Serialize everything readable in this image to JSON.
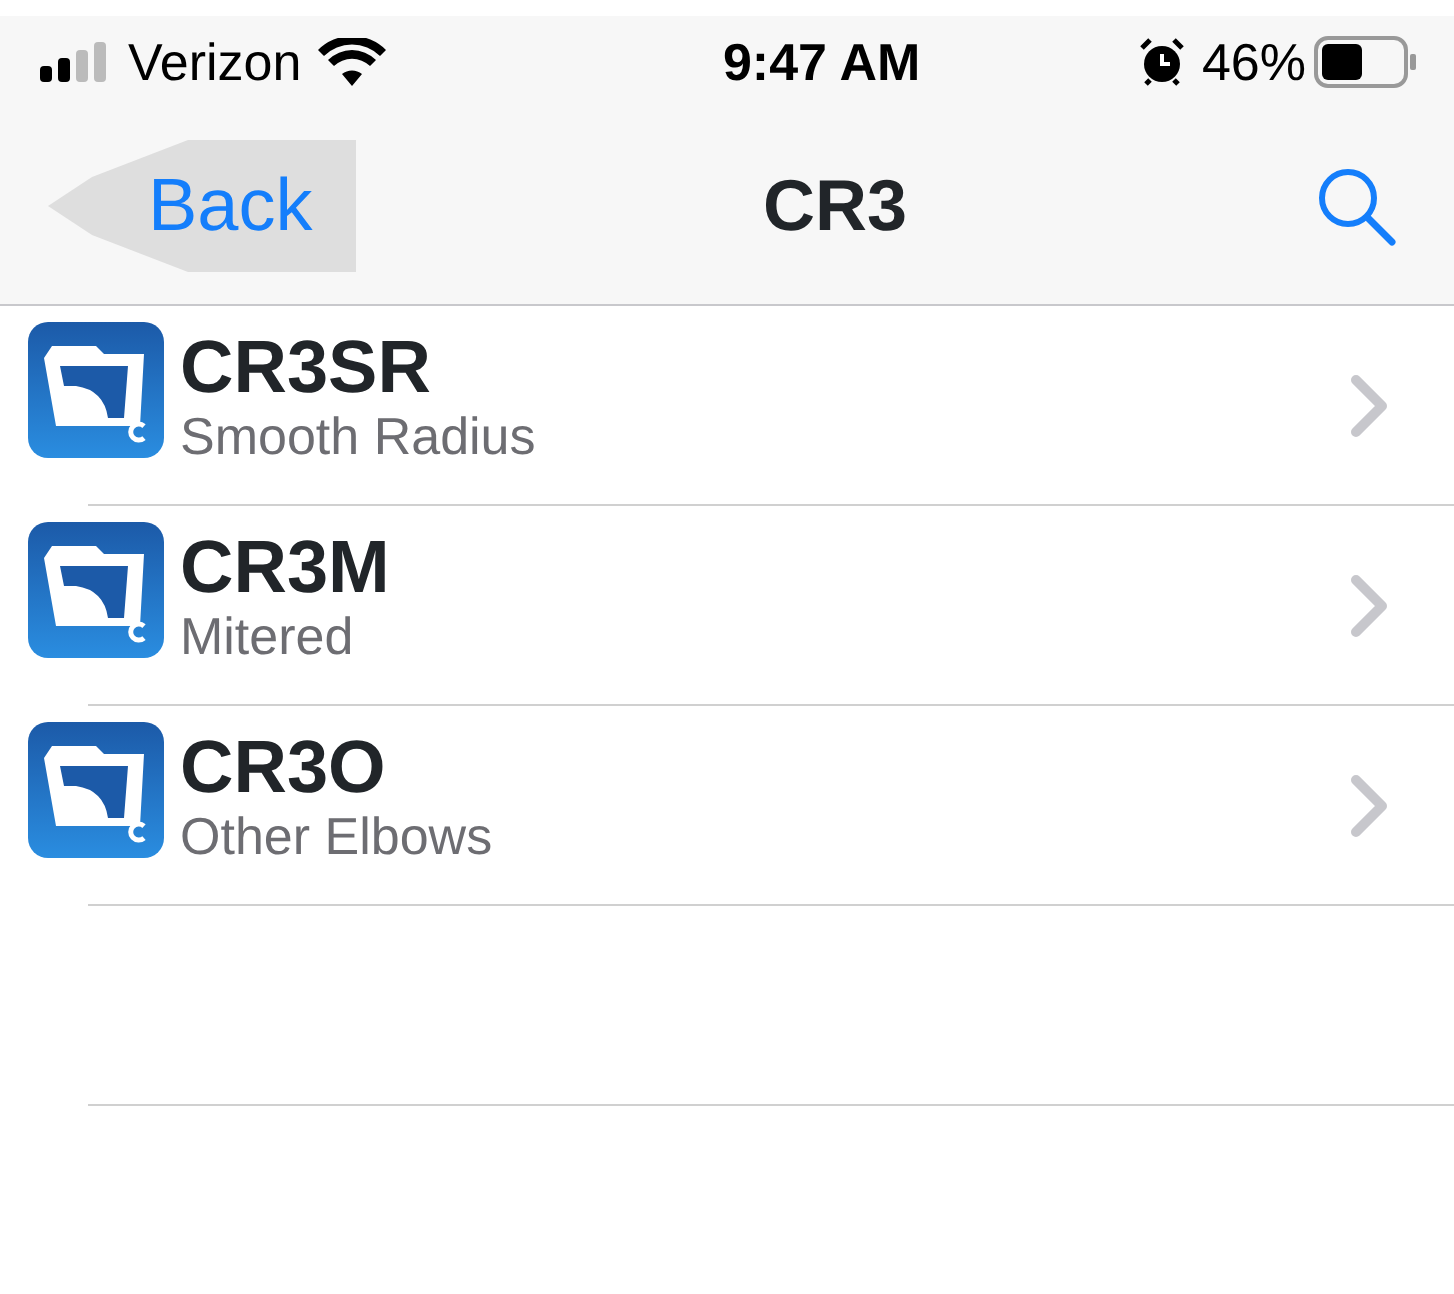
{
  "status_bar": {
    "carrier": "Verizon",
    "time": "9:47 AM",
    "battery": "46%"
  },
  "nav_bar": {
    "back": "Back",
    "title": "CR3"
  },
  "list": [
    {
      "title": "CR3SR",
      "subtitle": "Smooth Radius"
    },
    {
      "title": "CR3M",
      "subtitle": "Mitered"
    },
    {
      "title": "CR3O",
      "subtitle": "Other Elbows"
    }
  ]
}
